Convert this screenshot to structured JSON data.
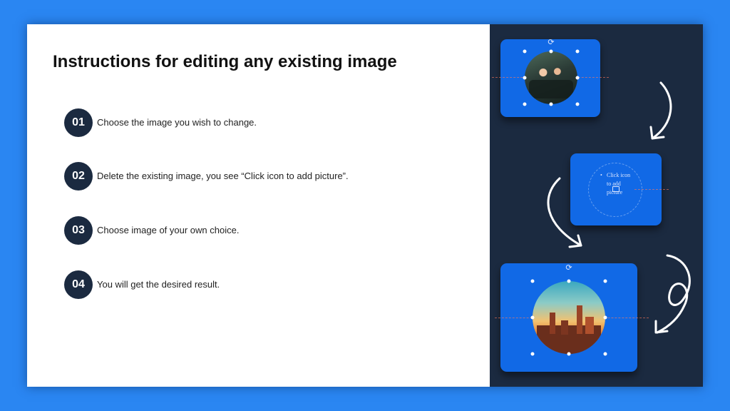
{
  "title": "Instructions for editing any existing image",
  "steps": [
    {
      "num": "01",
      "text": "Choose the image you wish to change."
    },
    {
      "num": "02",
      "text": "Delete the existing image, you see “Click icon to add picture”."
    },
    {
      "num": "03",
      "text": "Choose image of your own choice."
    },
    {
      "num": "04",
      "text": "You will get the desired result."
    }
  ],
  "placeholder": {
    "bullet": "•",
    "text": "Click icon to add picture"
  },
  "colors": {
    "background": "#2a86f2",
    "panel_dark": "#1b2a40",
    "card_blue": "#1169e6",
    "badge": "#1b2a40",
    "text": "#111111"
  },
  "icons": [
    "rotate-handle-icon",
    "picture-placeholder-icon",
    "curved-arrow-icon",
    "loop-arrow-icon"
  ]
}
